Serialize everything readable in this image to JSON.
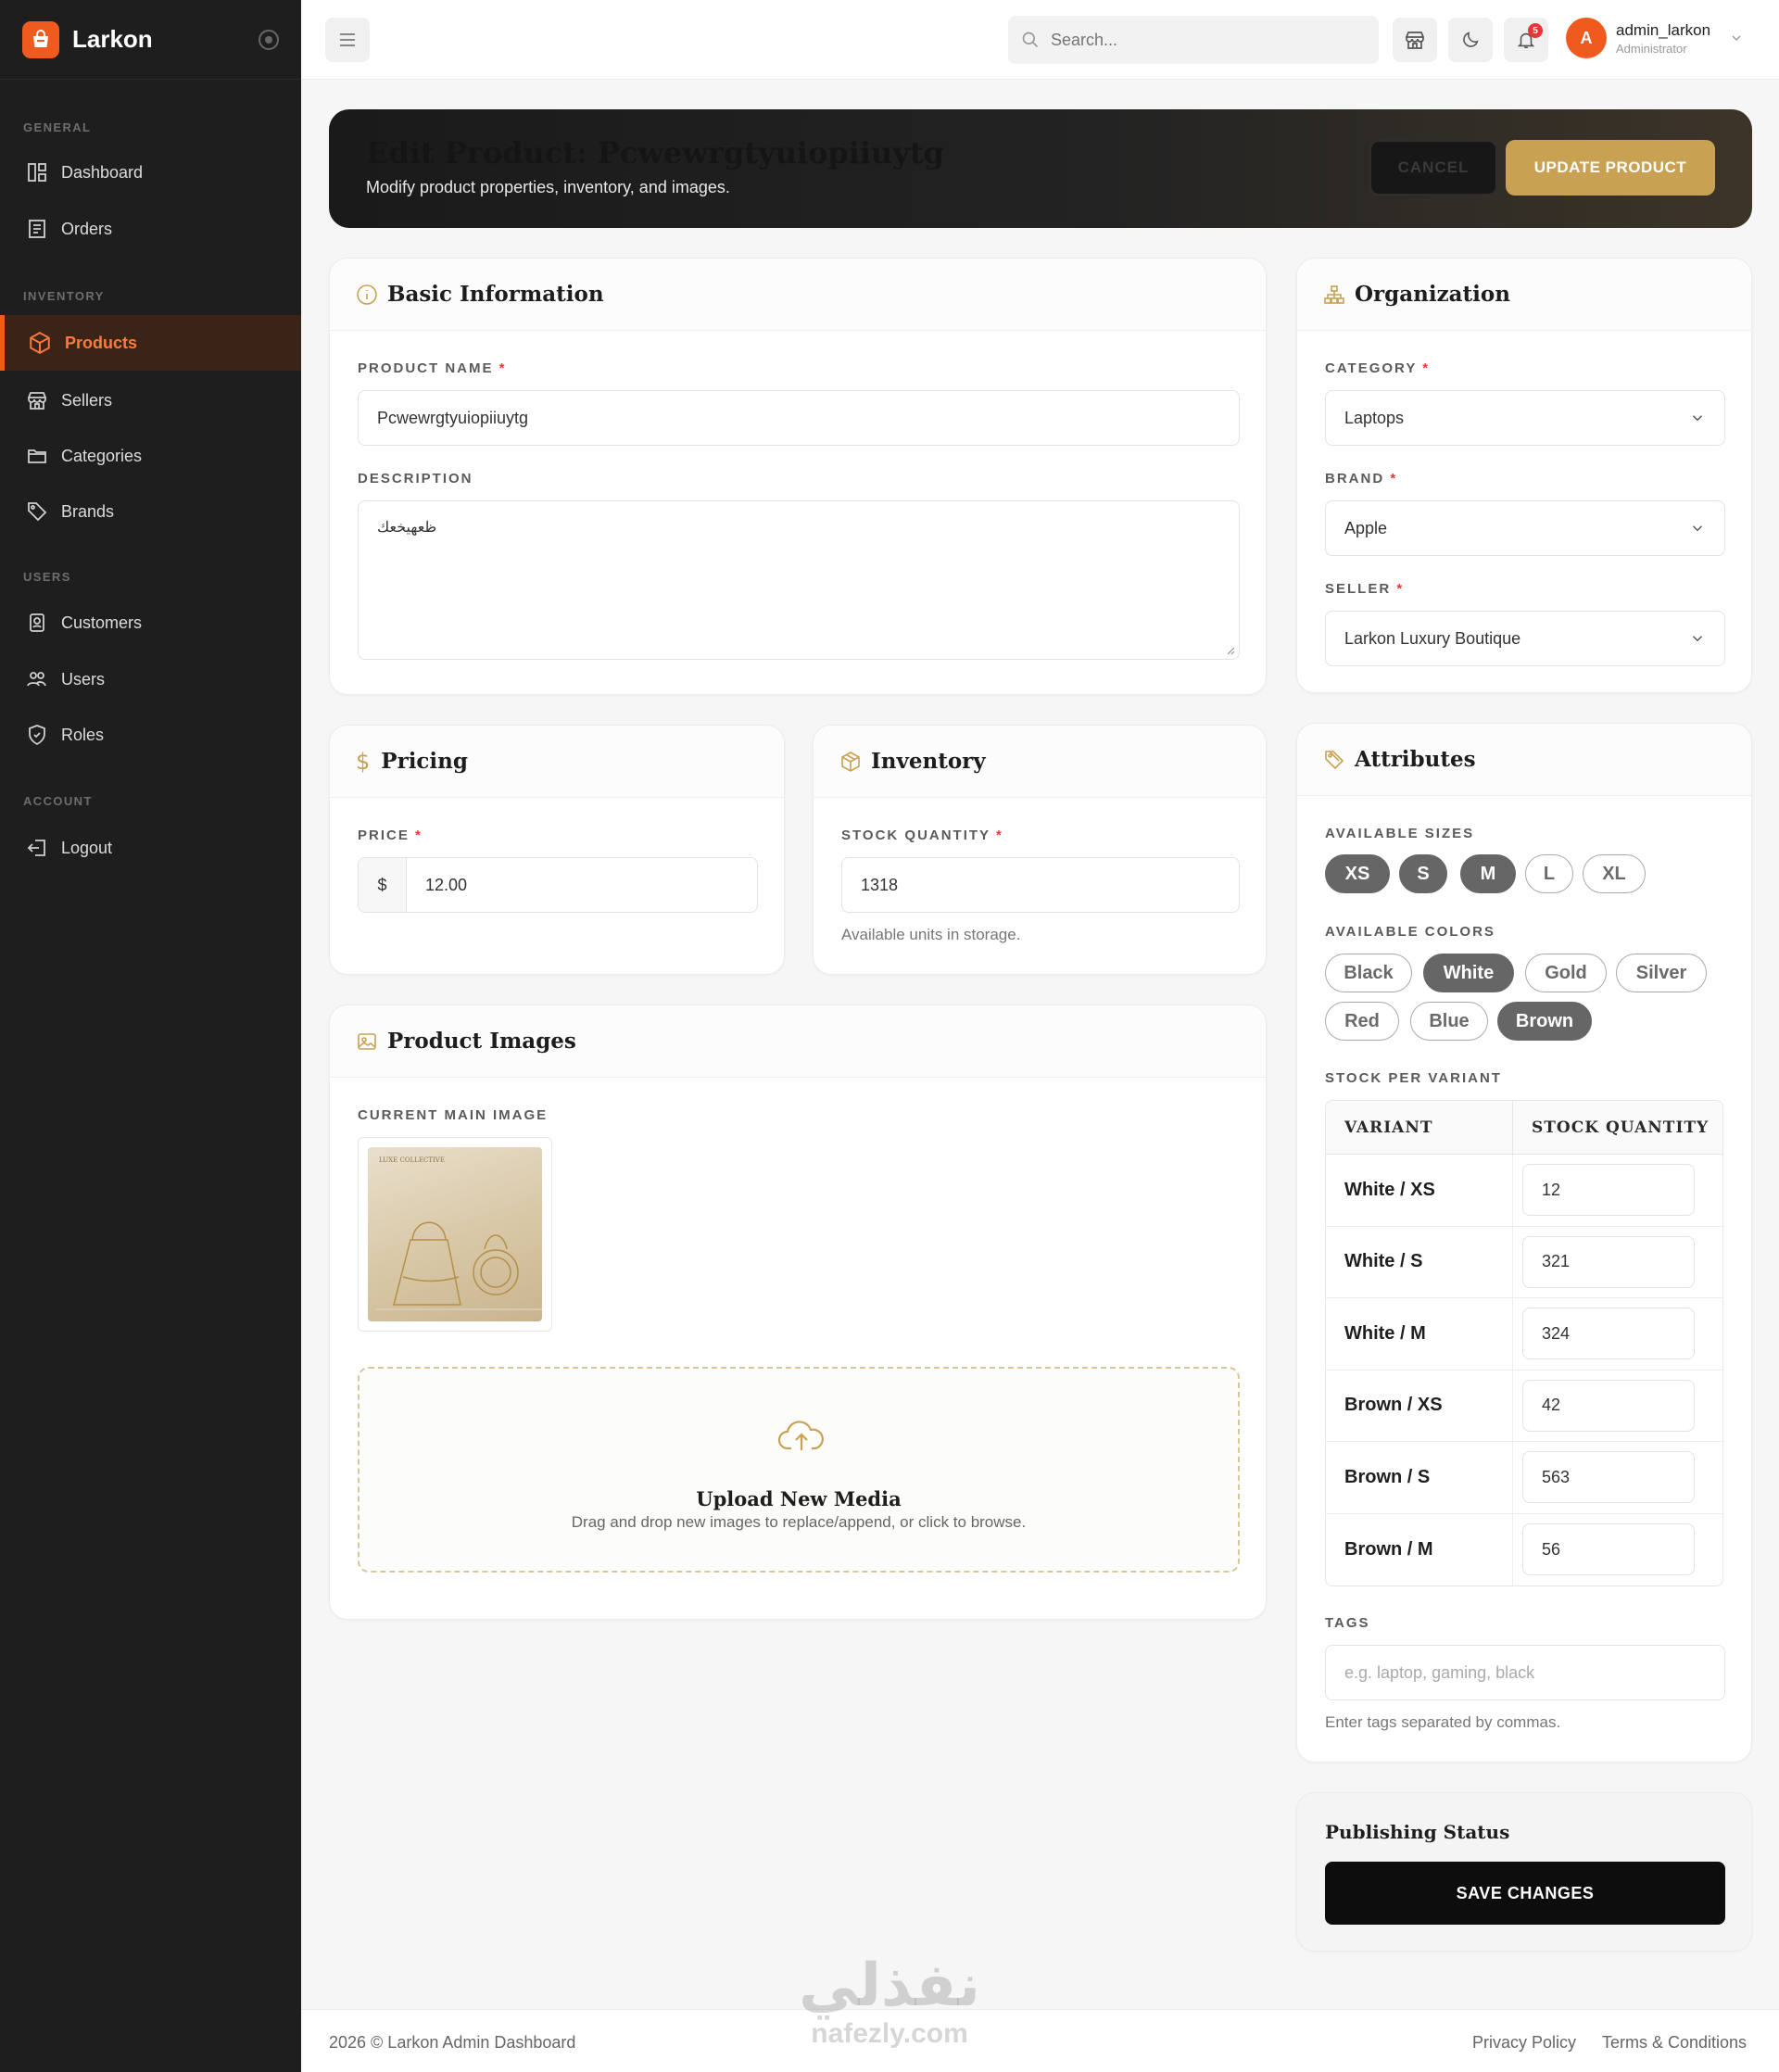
{
  "sidebar": {
    "brand": "Larkon",
    "sections": [
      {
        "title": "GENERAL",
        "items": [
          {
            "label": "Dashboard"
          },
          {
            "label": "Orders"
          }
        ]
      },
      {
        "title": "INVENTORY",
        "items": [
          {
            "label": "Products"
          },
          {
            "label": "Sellers"
          },
          {
            "label": "Categories"
          },
          {
            "label": "Brands"
          }
        ]
      },
      {
        "title": "USERS",
        "items": [
          {
            "label": "Customers"
          },
          {
            "label": "Users"
          },
          {
            "label": "Roles"
          }
        ]
      },
      {
        "title": "ACCOUNT",
        "items": [
          {
            "label": "Logout"
          }
        ]
      }
    ],
    "active_item": "Products"
  },
  "topbar": {
    "search_placeholder": "Search...",
    "notification_count": "5",
    "user": {
      "initial": "A",
      "name": "admin_larkon",
      "role": "Administrator"
    }
  },
  "header": {
    "title": "Edit Product: Pcwewrgtyuiopiiuytg",
    "subtitle": "Modify product properties, inventory, and images.",
    "cancel_label": "CANCEL",
    "update_label": "UPDATE PRODUCT"
  },
  "basic_info": {
    "title": "Basic Information",
    "product_name_label": "PRODUCT NAME",
    "product_name_value": "Pcwewrgtyuiopiiuytg",
    "description_label": "DESCRIPTION",
    "description_value": "ظعهيخعك"
  },
  "organization": {
    "title": "Organization",
    "category_label": "CATEGORY",
    "category_value": "Laptops",
    "brand_label": "BRAND",
    "brand_value": "Apple",
    "seller_label": "SELLER",
    "seller_value": "Larkon Luxury Boutique"
  },
  "pricing": {
    "title": "Pricing",
    "price_label": "PRICE",
    "currency": "$",
    "price_value": "12.00"
  },
  "inventory": {
    "title": "Inventory",
    "stock_label": "STOCK QUANTITY",
    "stock_value": "1318",
    "help": "Available units in storage."
  },
  "images": {
    "title": "Product Images",
    "current_label": "CURRENT MAIN IMAGE",
    "image_caption": "LUXE COLLECTIVE",
    "upload_title": "Upload New Media",
    "upload_help": "Drag and drop new images to replace/append, or click to browse."
  },
  "attributes": {
    "title": "Attributes",
    "sizes_label": "AVAILABLE SIZES",
    "sizes": [
      {
        "label": "XS",
        "selected": true
      },
      {
        "label": "S",
        "selected": true
      },
      {
        "label": "M",
        "selected": true
      },
      {
        "label": "L",
        "selected": false
      },
      {
        "label": "XL",
        "selected": false
      }
    ],
    "colors_label": "AVAILABLE COLORS",
    "colors": [
      {
        "label": "Black",
        "selected": false
      },
      {
        "label": "White",
        "selected": true
      },
      {
        "label": "Gold",
        "selected": false
      },
      {
        "label": "Silver",
        "selected": false
      },
      {
        "label": "Red",
        "selected": false
      },
      {
        "label": "Blue",
        "selected": false
      },
      {
        "label": "Brown",
        "selected": true
      }
    ],
    "variant_label": "STOCK PER VARIANT",
    "variant_headers": [
      "VARIANT",
      "STOCK QUANTITY"
    ],
    "variants": [
      {
        "name": "White / XS",
        "stock": "12"
      },
      {
        "name": "White / S",
        "stock": "321"
      },
      {
        "name": "White / M",
        "stock": "324"
      },
      {
        "name": "Brown / XS",
        "stock": "42"
      },
      {
        "name": "Brown / S",
        "stock": "563"
      },
      {
        "name": "Brown / M",
        "stock": "56"
      }
    ],
    "tags_label": "TAGS",
    "tags_placeholder": "e.g. laptop, gaming, black",
    "tags_help": "Enter tags separated by commas."
  },
  "publishing": {
    "title": "Publishing Status",
    "save_label": "SAVE CHANGES"
  },
  "footer": {
    "copyright": "2026 © Larkon Admin Dashboard",
    "privacy": "Privacy Policy",
    "terms": "Terms & Conditions"
  },
  "watermark": {
    "arabic": "نفذلي",
    "latin": "nafezly.com"
  },
  "colors": {
    "accent": "#f05a1e",
    "gold": "#c9a152",
    "sidebar": "#1e1e1e"
  }
}
